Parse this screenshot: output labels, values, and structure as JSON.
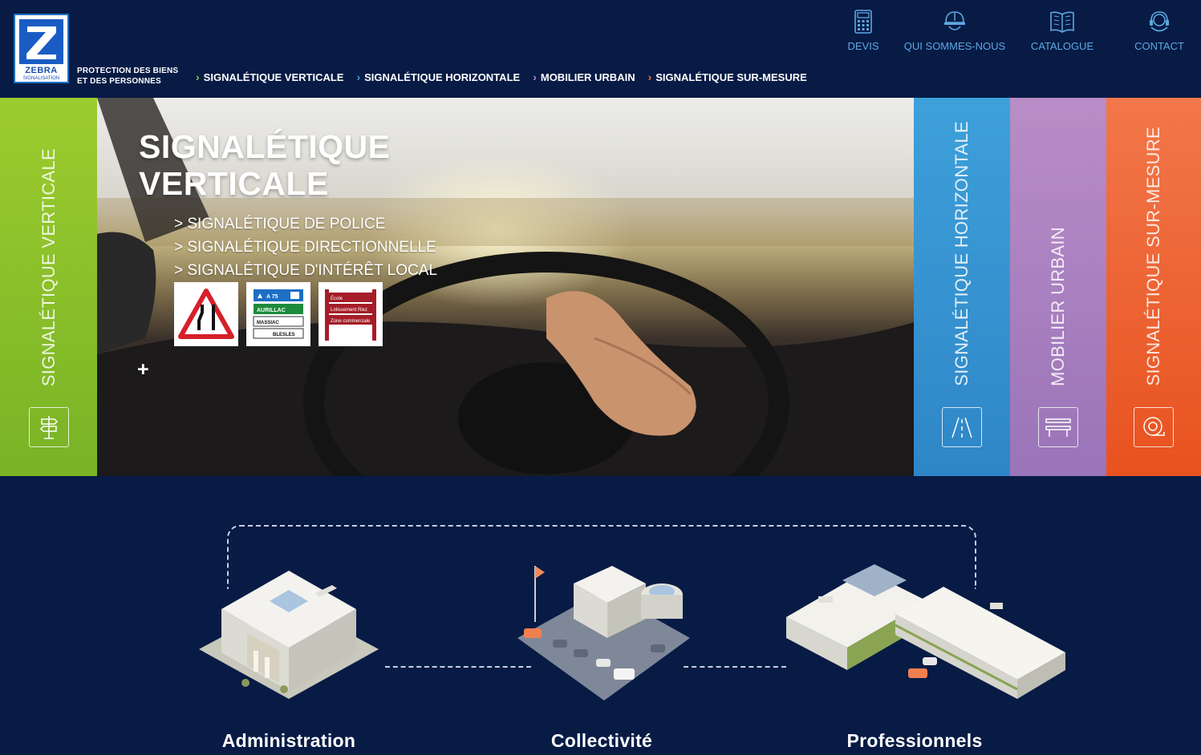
{
  "header": {
    "logo": {
      "name": "ZEBRA",
      "sub": "SIGNALISATION"
    },
    "tagline_line1": "PROTECTION DES BIENS",
    "tagline_line2": "ET DES PERSONNES",
    "main_nav": [
      {
        "label": "SIGNALÉTIQUE VERTICALE",
        "color": "#8cc63f"
      },
      {
        "label": "SIGNALÉTIQUE HORIZONTALE",
        "color": "#3aa0dc"
      },
      {
        "label": "MOBILIER URBAIN",
        "color": "#b889c8"
      },
      {
        "label": "SIGNALÉTIQUE SUR-MESURE",
        "color": "#f26b3a"
      }
    ],
    "top_nav": [
      {
        "label": "DEVIS",
        "icon": "calculator-icon"
      },
      {
        "label": "QUI SOMMES-NOUS",
        "icon": "hard-hat-icon"
      },
      {
        "label": "CATALOGUE",
        "icon": "book-icon"
      },
      {
        "label": "CONTACT",
        "icon": "headset-icon"
      }
    ]
  },
  "hero": {
    "title_line1": "SIGNALÉTIQUE",
    "title_line2": "VERTICALE",
    "links": [
      "> SIGNALÉTIQUE DE POLICE",
      "> SIGNALÉTIQUE DIRECTIONNELLE",
      "> SIGNALÉTIQUE D'INTÉRÊT LOCAL"
    ],
    "more": "+",
    "signs": {
      "directional": [
        "A 75",
        "AURILLAC",
        "MASSIAC",
        "BLESLES"
      ],
      "local": [
        "École",
        "Lotissement Riez",
        "Zone commerciale"
      ]
    },
    "panels": {
      "left": "SIGNALÉTIQUE VERTICALE",
      "right": [
        "SIGNALÉTIQUE HORIZONTALE",
        "MOBILIER URBAIN",
        "SIGNALÉTIQUE SUR-MESURE"
      ]
    }
  },
  "segments": [
    "Administration",
    "Collectivité",
    "Professionnels"
  ]
}
